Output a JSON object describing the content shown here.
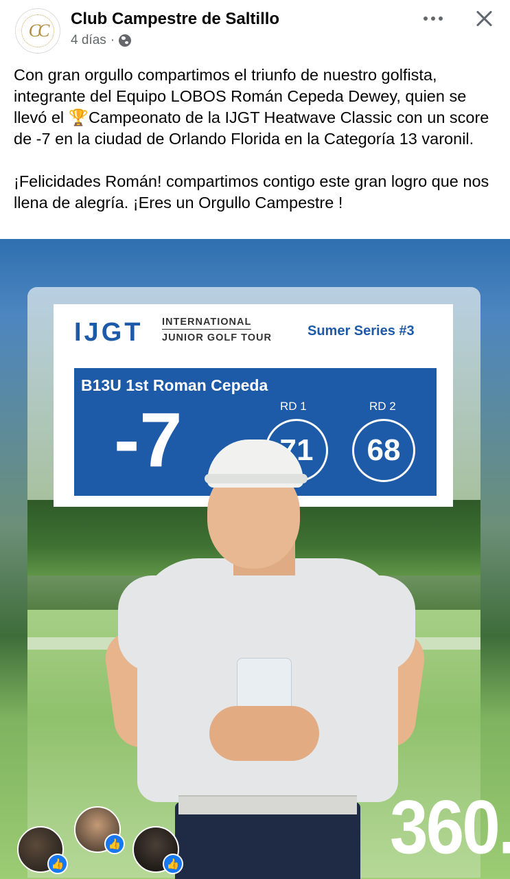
{
  "post": {
    "page_name": "Club Campestre de Saltillo",
    "timestamp": "4 días",
    "separator": "·",
    "avatar_monogram": "CC",
    "privacy_icon": "globe-icon",
    "paragraph_1": "Con gran orgullo compartimos el triunfo de nuestro golfista, integrante del Equipo LOBOS  Román Cepeda Dewey, quien se llevó el 🏆Campeonato de la IJGT Heatwave Classic con un score de -7 en la ciudad de  Orlando Florida en la Categoría 13 varonil.",
    "paragraph_2": "¡Felicidades Román! compartimos contigo este gran logro que nos llena de alegría. ¡Eres un Orgullo Campestre !"
  },
  "scorecard": {
    "logo": "IJGT",
    "tour_line_1": "INTERNATIONAL",
    "tour_line_2": "JUNIOR GOLF TOUR",
    "series": "Sumer Series #3",
    "player": "B13U 1st Roman Cepeda",
    "total": "-7",
    "rd1_label": "RD 1",
    "rd1_score": "71",
    "rd2_label": "RD 2",
    "rd2_score": "68"
  },
  "watermark": "360.",
  "icons": {
    "more": "more-options-icon",
    "close": "close-icon",
    "like": "like-icon"
  },
  "colors": {
    "ijgt_blue": "#1d5aa8",
    "facebook_blue": "#1877f2",
    "meta_gray": "#65676b"
  }
}
